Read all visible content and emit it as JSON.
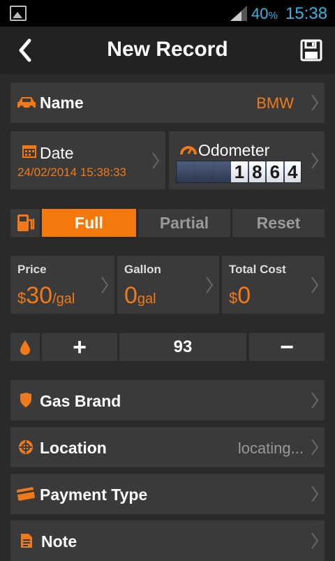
{
  "status": {
    "battery": "40",
    "battery_unit": "%",
    "time": "15:38"
  },
  "header": {
    "title": "New Record"
  },
  "name_row": {
    "label": "Name",
    "value": "BMW"
  },
  "date_card": {
    "label": "Date",
    "value": "24/02/2014 15:38:33"
  },
  "odometer_card": {
    "label": "Odometer",
    "digits": [
      "",
      "",
      "",
      "1",
      "8",
      "6",
      "4"
    ]
  },
  "fill_type": {
    "options": [
      "Full",
      "Partial",
      "Reset"
    ],
    "selected": "Full"
  },
  "price_cards": [
    {
      "label": "Price",
      "currency": "$",
      "value": "30",
      "unit": "/gal"
    },
    {
      "label": "Gallon",
      "currency": "",
      "value": "0",
      "unit": "gal"
    },
    {
      "label": "Total Cost",
      "currency": "$",
      "value": "0",
      "unit": ""
    }
  ],
  "octane": {
    "plus": "+",
    "value": "93",
    "minus": "−"
  },
  "rows": {
    "gas_brand": {
      "label": "Gas Brand"
    },
    "location": {
      "label": "Location",
      "value": "locating..."
    },
    "payment": {
      "label": "Payment Type"
    },
    "note": {
      "label": "Note"
    }
  },
  "colors": {
    "accent": "#f5780c",
    "status_text": "#33b5e5",
    "card": "#3a3a3a",
    "background": "#2a2a2a"
  }
}
